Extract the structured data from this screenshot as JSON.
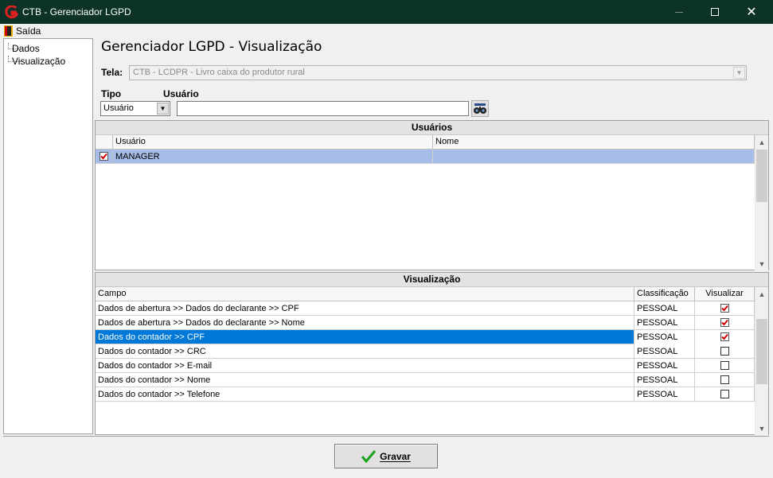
{
  "window": {
    "title": "CTB - Gerenciador LGPD",
    "minimize": "—",
    "maximize": "☐",
    "close": "✕"
  },
  "menu": {
    "exit_label": "Saída"
  },
  "tree": {
    "items": [
      {
        "label": "Dados"
      },
      {
        "label": "Visualização"
      }
    ]
  },
  "header": {
    "title": "Gerenciador LGPD - Visualização"
  },
  "form": {
    "tela_label": "Tela:",
    "tela_value": "CTB - LCDPR - Livro caixa do produtor rural",
    "tipo_label": "Tipo",
    "tipo_value": "Usuário",
    "usuario_label": "Usuário",
    "usuario_value": ""
  },
  "users_grid": {
    "title": "Usuários",
    "columns": [
      "Usuário",
      "Nome"
    ],
    "rows": [
      {
        "checked": true,
        "usuario": "MANAGER",
        "nome": ""
      }
    ]
  },
  "view_grid": {
    "title": "Visualização",
    "columns": [
      "Campo",
      "Classificação",
      "Visualizar"
    ],
    "rows": [
      {
        "campo": "Dados de abertura >>  Dados do declarante  >> CPF",
        "classificacao": "PESSOAL",
        "visualizar": true
      },
      {
        "campo": "Dados de abertura >>  Dados do declarante  >> Nome",
        "classificacao": "PESSOAL",
        "visualizar": true
      },
      {
        "campo": "Dados do contador >> CPF",
        "classificacao": "PESSOAL",
        "visualizar": true
      },
      {
        "campo": "Dados do contador >> CRC",
        "classificacao": "PESSOAL",
        "visualizar": false
      },
      {
        "campo": "Dados do contador >> E-mail",
        "classificacao": "PESSOAL",
        "visualizar": false
      },
      {
        "campo": "Dados do contador >> Nome",
        "classificacao": "PESSOAL",
        "visualizar": false
      },
      {
        "campo": "Dados do contador >> Telefone",
        "classificacao": "PESSOAL",
        "visualizar": false
      }
    ]
  },
  "buttons": {
    "save_label": "Gravar"
  },
  "colors": {
    "titlebar": "#0d3328",
    "user_row_selected": "#a6bde7",
    "view_row_selected": "#0078d7",
    "check_mark": "#d00000",
    "save_check": "#1aa31a"
  }
}
